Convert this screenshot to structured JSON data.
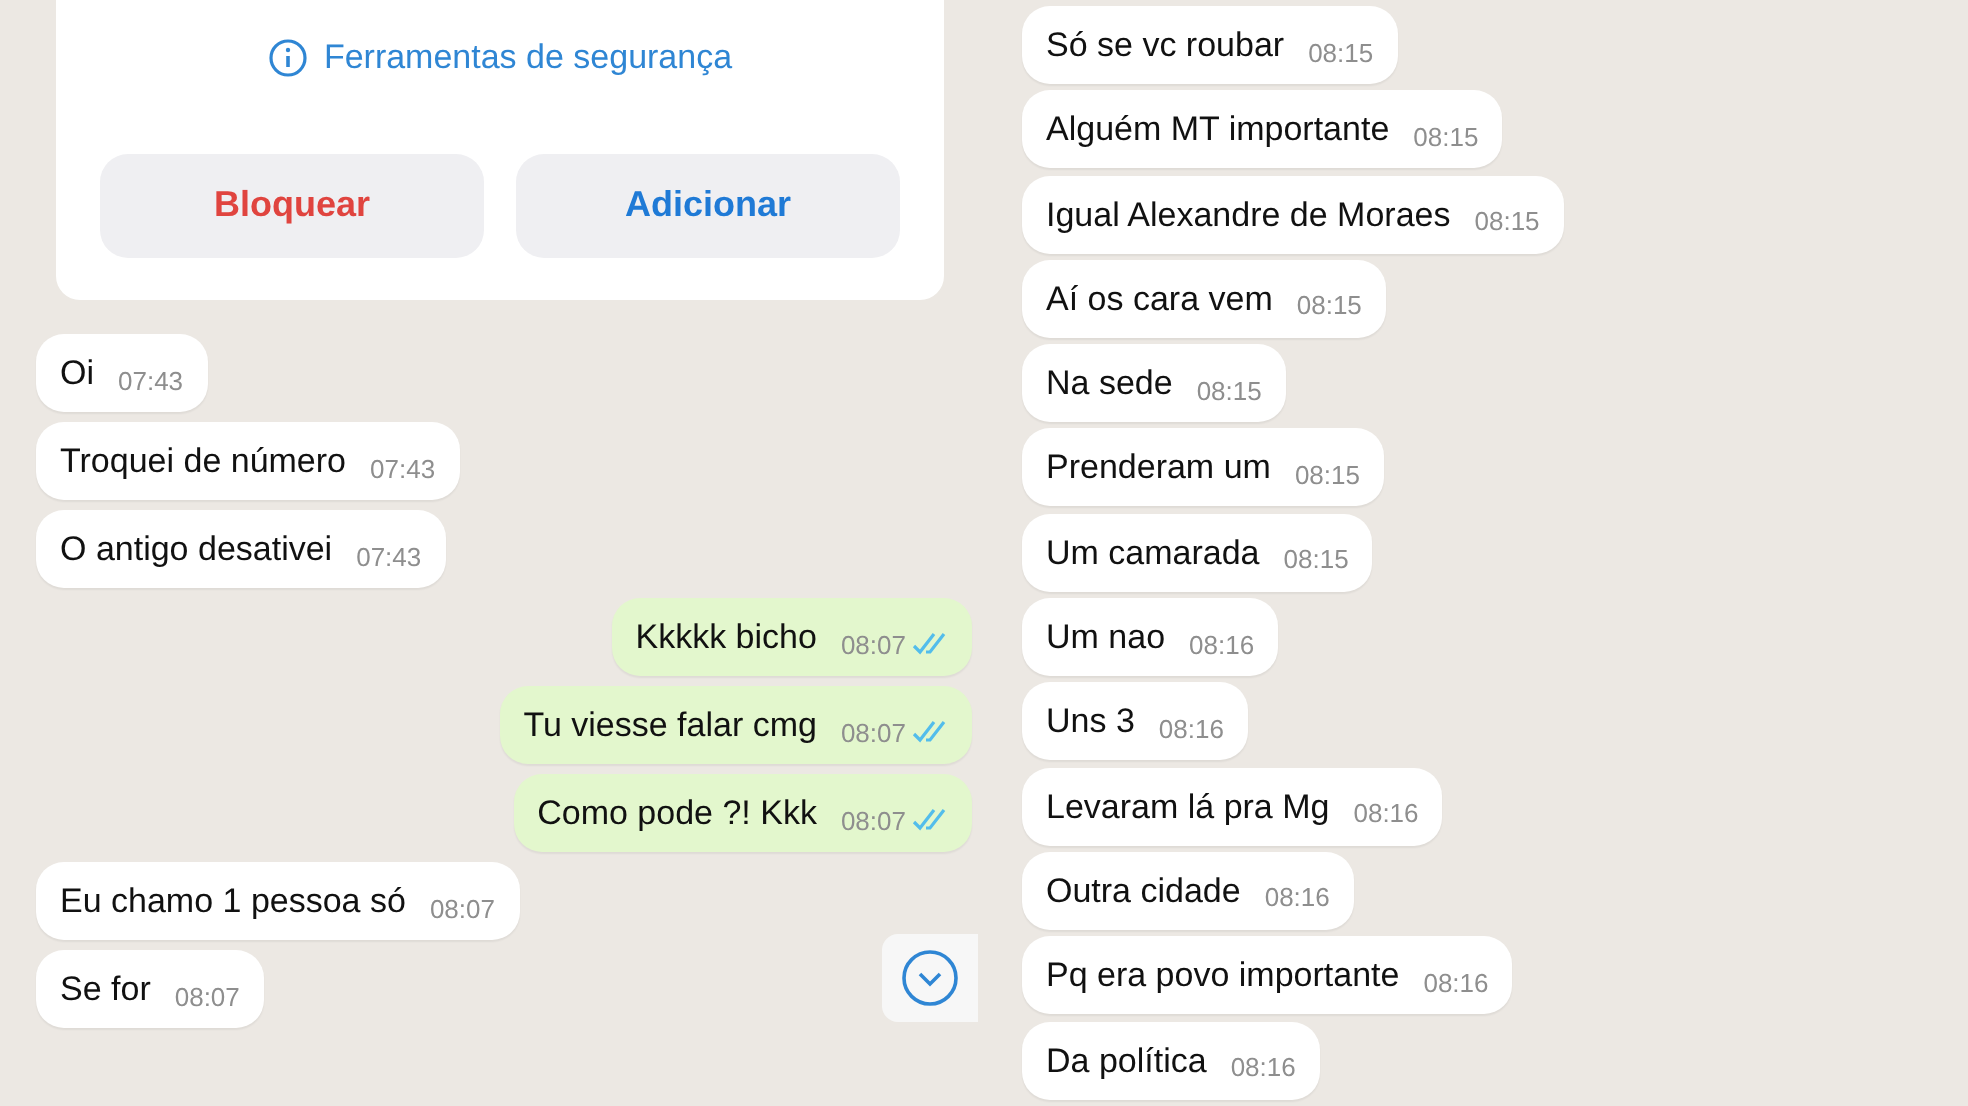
{
  "left_panel": {
    "contact_card": {
      "safety_link": "Ferramentas de segurança",
      "buttons": [
        {
          "label": "Bloquear",
          "kind": "danger"
        },
        {
          "label": "Adicionar",
          "kind": "primary"
        }
      ]
    },
    "messages": [
      {
        "kind": "incoming",
        "text": "Oi",
        "time": "07:43"
      },
      {
        "kind": "incoming",
        "text": "Troquei de número",
        "time": "07:43"
      },
      {
        "kind": "incoming",
        "text": "O antigo desativei",
        "time": "07:43"
      },
      {
        "kind": "outgoing",
        "text": "Kkkkk bicho",
        "time": "08:07",
        "read": true
      },
      {
        "kind": "outgoing",
        "text": "Tu viesse falar cmg",
        "time": "08:07",
        "read": true
      },
      {
        "kind": "outgoing",
        "text": "Como pode ?! Kkk",
        "time": "08:07",
        "read": true
      },
      {
        "kind": "incoming",
        "text": "Eu chamo 1 pessoa só",
        "time": "08:07"
      },
      {
        "kind": "incoming",
        "text": "Se for",
        "time": "08:07"
      }
    ]
  },
  "right_panel": {
    "messages": [
      {
        "kind": "incoming",
        "text": "Só se vc roubar",
        "time": "08:15"
      },
      {
        "kind": "incoming",
        "text": "Alguém MT importante",
        "time": "08:15"
      },
      {
        "kind": "incoming",
        "text": "Igual Alexandre de Moraes",
        "time": "08:15"
      },
      {
        "kind": "incoming",
        "text": "Aí os cara vem",
        "time": "08:15"
      },
      {
        "kind": "incoming",
        "text": "Na sede",
        "time": "08:15"
      },
      {
        "kind": "incoming",
        "text": "Prenderam um",
        "time": "08:15"
      },
      {
        "kind": "incoming",
        "text": "Um camarada",
        "time": "08:15"
      },
      {
        "kind": "incoming",
        "text": "Um nao",
        "time": "08:16"
      },
      {
        "kind": "incoming",
        "text": "Uns 3",
        "time": "08:16"
      },
      {
        "kind": "incoming",
        "text": "Levaram lá pra Mg",
        "time": "08:16"
      },
      {
        "kind": "incoming",
        "text": "Outra cidade",
        "time": "08:16"
      },
      {
        "kind": "incoming",
        "text": "Pq era povo importante",
        "time": "08:16"
      },
      {
        "kind": "incoming",
        "text": "Da política",
        "time": "08:16"
      }
    ]
  }
}
